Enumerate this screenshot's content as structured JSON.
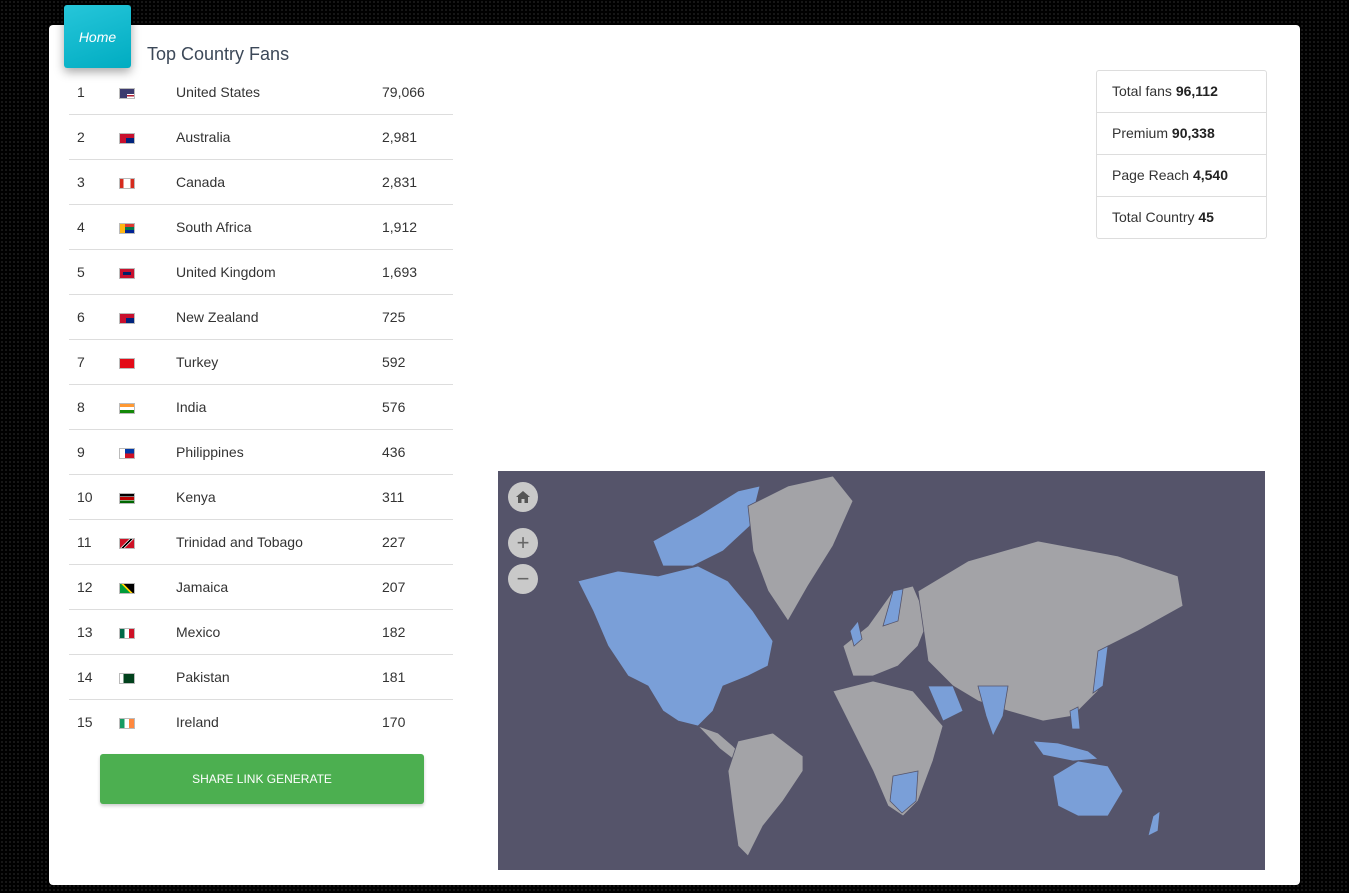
{
  "nav": {
    "home_label": "Home"
  },
  "page": {
    "title": "Top Country Fans"
  },
  "rows": [
    {
      "rank": "1",
      "country": "United States",
      "fans": "79,066",
      "flag": "flag-us-icon"
    },
    {
      "rank": "2",
      "country": "Australia",
      "fans": "2,981",
      "flag": "flag-au-icon"
    },
    {
      "rank": "3",
      "country": "Canada",
      "fans": "2,831",
      "flag": "flag-ca-icon"
    },
    {
      "rank": "4",
      "country": "South Africa",
      "fans": "1,912",
      "flag": "flag-za-icon"
    },
    {
      "rank": "5",
      "country": "United Kingdom",
      "fans": "1,693",
      "flag": "flag-gb-icon"
    },
    {
      "rank": "6",
      "country": "New Zealand",
      "fans": "725",
      "flag": "flag-nz-icon"
    },
    {
      "rank": "7",
      "country": "Turkey",
      "fans": "592",
      "flag": "flag-tr-icon"
    },
    {
      "rank": "8",
      "country": "India",
      "fans": "576",
      "flag": "flag-in-icon"
    },
    {
      "rank": "9",
      "country": "Philippines",
      "fans": "436",
      "flag": "flag-ph-icon"
    },
    {
      "rank": "10",
      "country": "Kenya",
      "fans": "311",
      "flag": "flag-ke-icon"
    },
    {
      "rank": "11",
      "country": "Trinidad and Tobago",
      "fans": "227",
      "flag": "flag-tt-icon"
    },
    {
      "rank": "12",
      "country": "Jamaica",
      "fans": "207",
      "flag": "flag-jm-icon"
    },
    {
      "rank": "13",
      "country": "Mexico",
      "fans": "182",
      "flag": "flag-mx-icon"
    },
    {
      "rank": "14",
      "country": "Pakistan",
      "fans": "181",
      "flag": "flag-pk-icon"
    },
    {
      "rank": "15",
      "country": "Ireland",
      "fans": "170",
      "flag": "flag-ie-icon"
    }
  ],
  "share_button": {
    "label": "SHARE LINK GENERATE"
  },
  "stats": [
    {
      "label": "Total fans",
      "value": "96,112"
    },
    {
      "label": "Premium",
      "value": "90,338"
    },
    {
      "label": "Page Reach",
      "value": "4,540"
    },
    {
      "label": "Total Country",
      "value": "45"
    }
  ],
  "map": {
    "background_color": "#55546a",
    "land_color": "#a3a3a7",
    "highlight_color": "#7a9fd8",
    "controls": {
      "home": "home-icon",
      "zoom_in": "plus-icon",
      "zoom_out": "minus-icon"
    }
  },
  "colors": {
    "home_tab": "#00bcd4",
    "share_button": "#4caf50"
  }
}
